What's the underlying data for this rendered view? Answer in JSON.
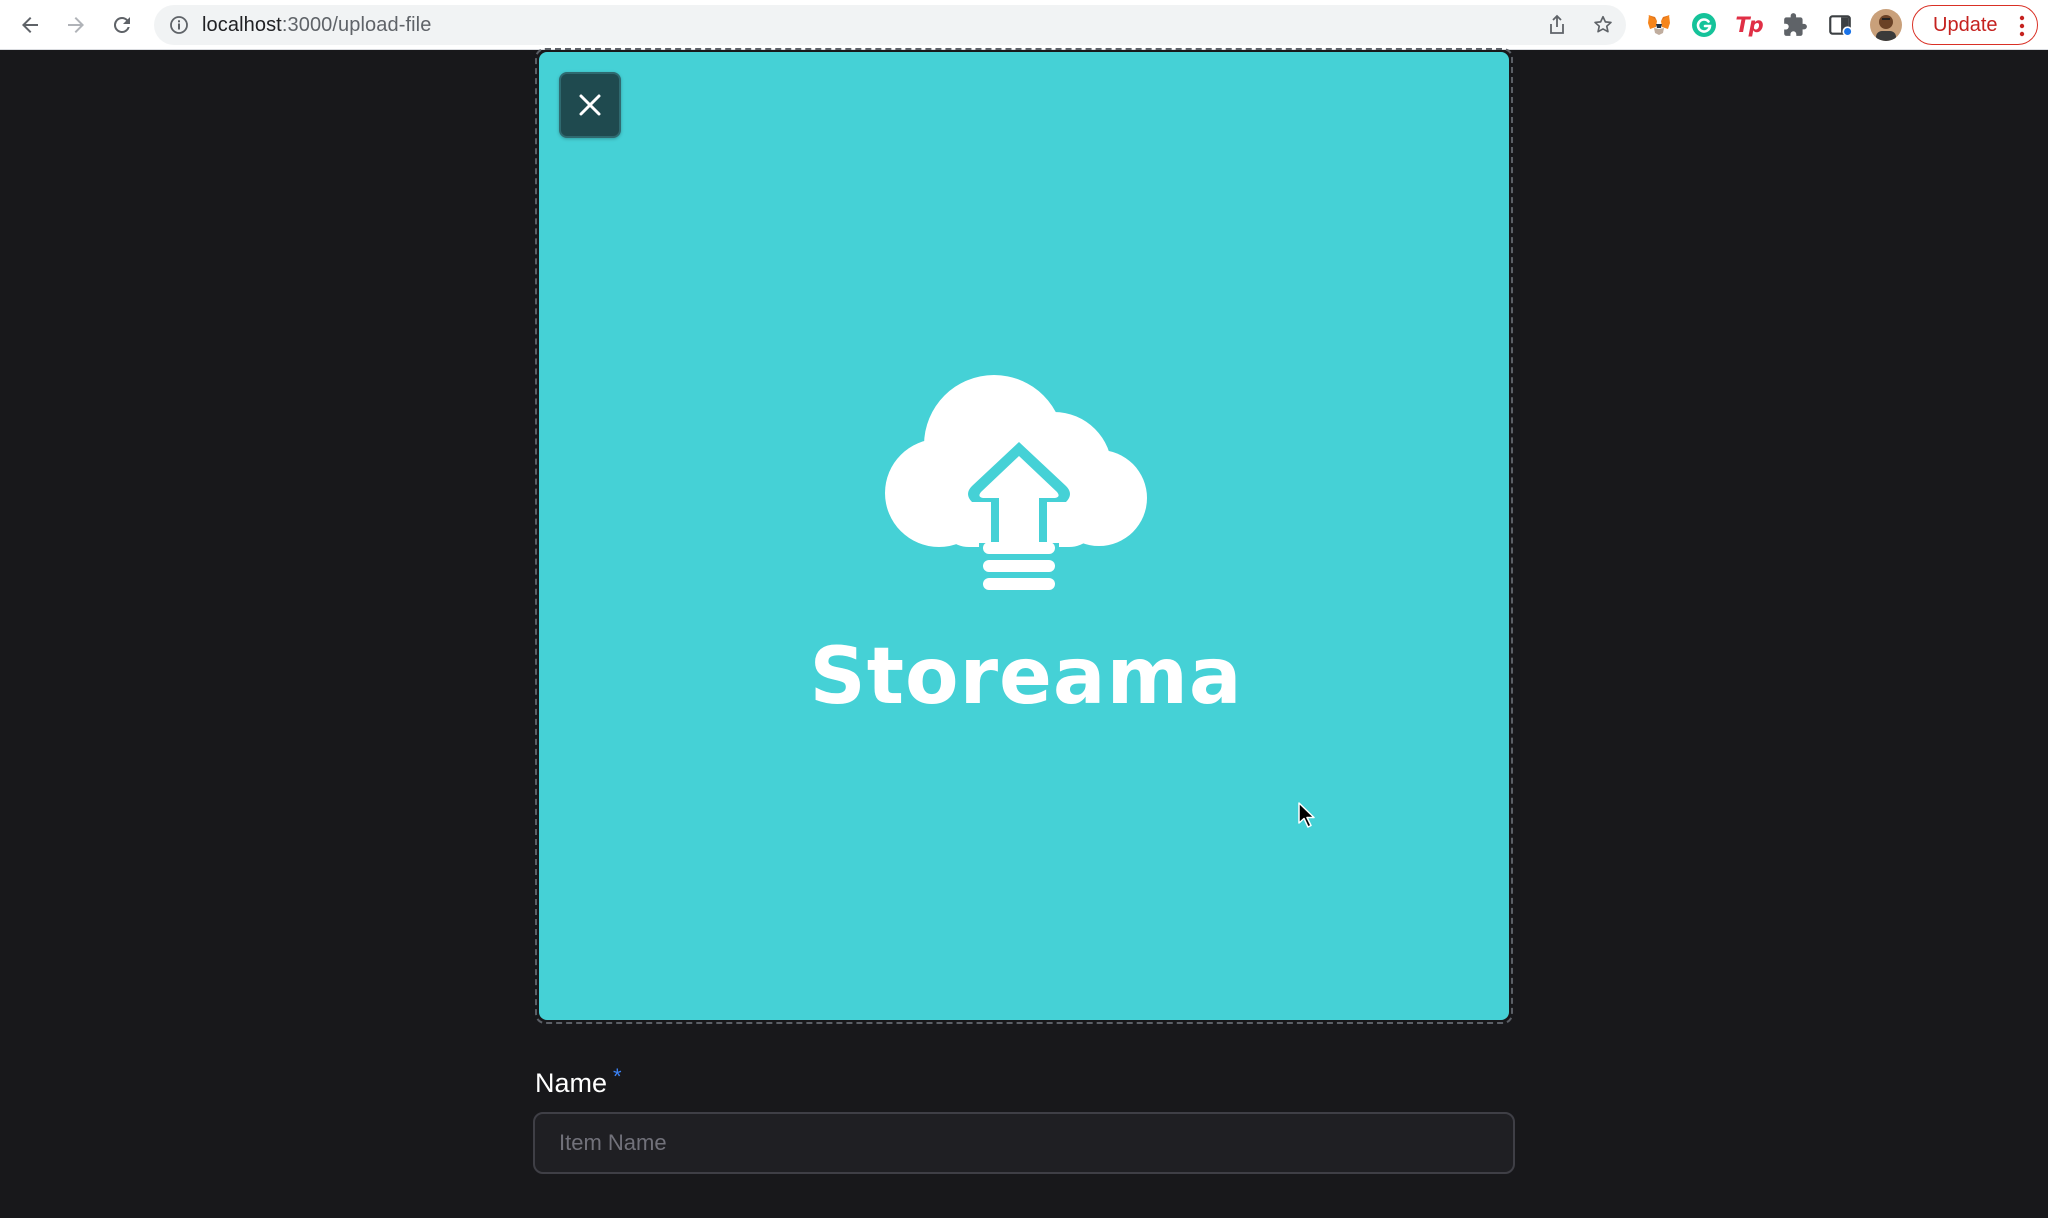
{
  "browser": {
    "url_host": "localhost",
    "url_rest": ":3000/upload-file",
    "update_label": "Update",
    "extensions": [
      "metamask-icon",
      "grammarly-icon",
      "tp-icon",
      "puzzle-extensions-icon",
      "side-panel-icon"
    ],
    "tp_label": "Tp"
  },
  "upload": {
    "brand_name": "Storeama",
    "preview_bg": "#45d1d6"
  },
  "form": {
    "name_label": "Name",
    "name_required": "*",
    "name_placeholder": "Item Name",
    "name_value": ""
  }
}
